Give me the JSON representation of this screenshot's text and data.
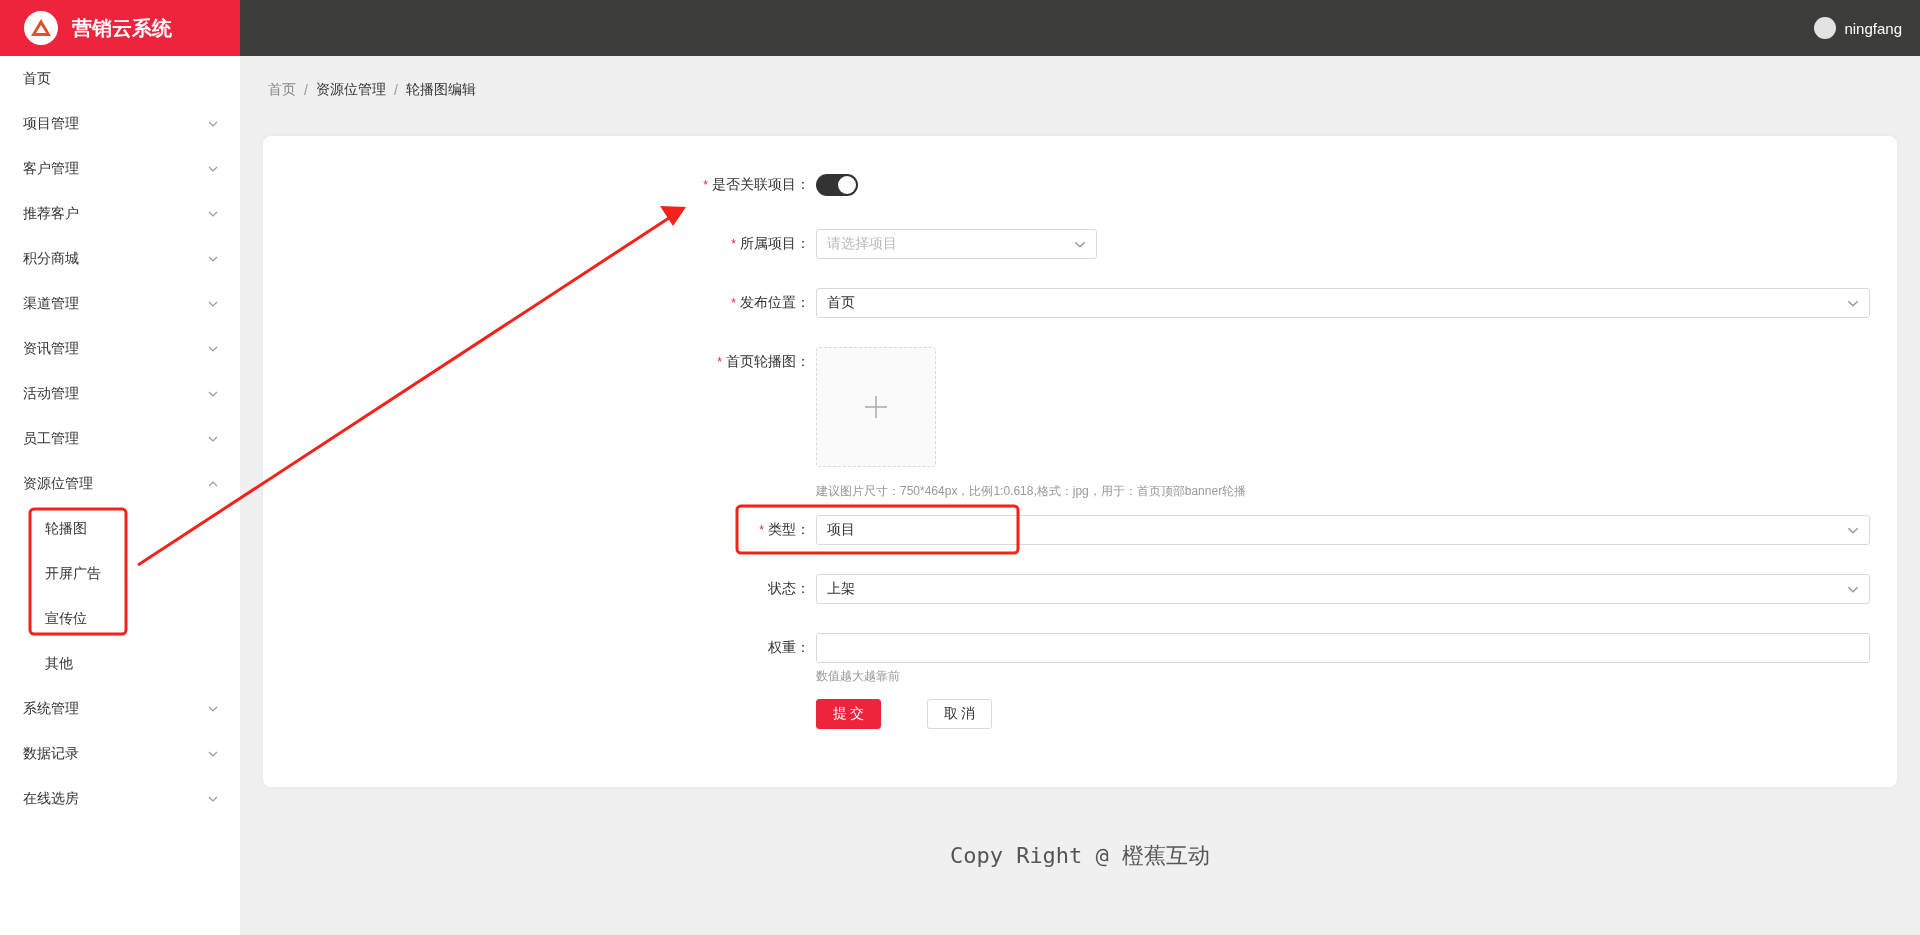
{
  "app": {
    "title": "营销云系统"
  },
  "user": {
    "name": "ningfang"
  },
  "sidebar": {
    "items": [
      {
        "label": "首页",
        "kind": "link"
      },
      {
        "label": "项目管理",
        "kind": "group",
        "expanded": false
      },
      {
        "label": "客户管理",
        "kind": "group",
        "expanded": false
      },
      {
        "label": "推荐客户",
        "kind": "group",
        "expanded": false
      },
      {
        "label": "积分商城",
        "kind": "group",
        "expanded": false
      },
      {
        "label": "渠道管理",
        "kind": "group",
        "expanded": false
      },
      {
        "label": "资讯管理",
        "kind": "group",
        "expanded": false
      },
      {
        "label": "活动管理",
        "kind": "group",
        "expanded": false
      },
      {
        "label": "员工管理",
        "kind": "group",
        "expanded": false
      },
      {
        "label": "资源位管理",
        "kind": "group",
        "expanded": true,
        "children": [
          {
            "label": "轮播图"
          },
          {
            "label": "开屏广告"
          },
          {
            "label": "宣传位"
          },
          {
            "label": "其他"
          }
        ]
      },
      {
        "label": "系统管理",
        "kind": "group",
        "expanded": false
      },
      {
        "label": "数据记录",
        "kind": "group",
        "expanded": false
      },
      {
        "label": "在线选房",
        "kind": "group",
        "expanded": false
      }
    ]
  },
  "breadcrumb": [
    {
      "kind": "home",
      "label": "首页"
    },
    {
      "kind": "separator",
      "label": "/"
    },
    {
      "kind": "link",
      "label": "资源位管理"
    },
    {
      "kind": "separator",
      "label": "/"
    },
    {
      "kind": "current",
      "label": "轮播图编辑"
    }
  ],
  "form": {
    "fields": [
      {
        "mark": "*",
        "label": "是否关联项目：",
        "kind": "switch",
        "on": true
      },
      {
        "mark": "*",
        "label": "所属项目：",
        "kind": "short-select",
        "placeholder": "请选择项目"
      },
      {
        "mark": "*",
        "label": "发布位置：",
        "kind": "select",
        "value": "首页"
      },
      {
        "mark": "*",
        "label": "首页轮播图：",
        "kind": "upload",
        "hint": "建议图片尺寸：750*464px，比例1:0.618,格式：jpg，用于：首页顶部banner轮播"
      },
      {
        "mark": "*",
        "label": "类型：",
        "kind": "select",
        "value": "项目"
      },
      {
        "label": "状态：",
        "kind": "select",
        "value": "上架"
      },
      {
        "label": "权重：",
        "kind": "input",
        "hint": "数值越大越靠前"
      }
    ],
    "buttons": [
      {
        "label": "提 交",
        "kind": "primary"
      },
      {
        "label": "取 消",
        "kind": "default"
      }
    ]
  },
  "footer": {
    "text": "Copy Right @ 橙蕉互动"
  }
}
